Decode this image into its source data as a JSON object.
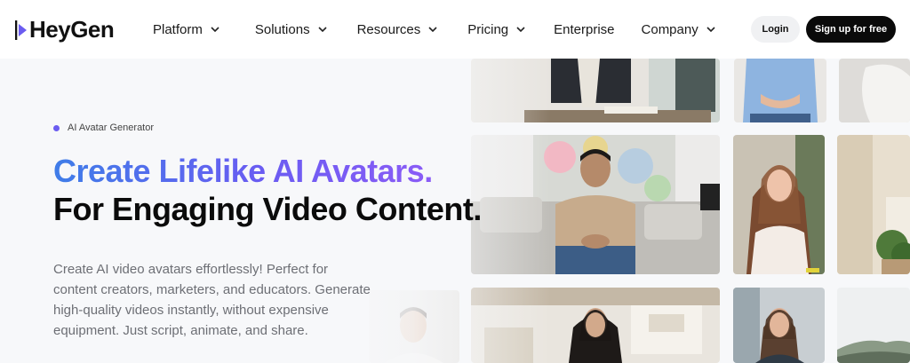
{
  "nav": {
    "logo_text": "HeyGen",
    "menu": [
      {
        "label": "Platform",
        "has_dropdown": true
      },
      {
        "label": "Solutions",
        "has_dropdown": true
      },
      {
        "label": "Resources",
        "has_dropdown": true
      },
      {
        "label": "Pricing",
        "has_dropdown": true
      },
      {
        "label": "Enterprise",
        "has_dropdown": false
      },
      {
        "label": "Company",
        "has_dropdown": true
      }
    ],
    "login_label": "Login",
    "signup_label": "Sign up for free"
  },
  "hero": {
    "badge": "AI Avatar Generator",
    "headline_line1": "Create Lifelike AI Avatars.",
    "headline_line2": "For Engaging Video Content.",
    "description": "Create AI video avatars effortlessly! Perfect for content creators, marketers, and educators. Generate high-quality videos instantly, without expensive equipment. Just script, animate, and share."
  },
  "colors": {
    "accent": "#6b5cf0",
    "gradient_start": "#3f7de8",
    "gradient_end": "#8b5cf6",
    "signup_bg": "#0a0a0a",
    "login_bg": "#f0f1f3"
  },
  "icons": {
    "logo": "play-triangle-icon",
    "dropdown": "chevron-down-icon"
  }
}
